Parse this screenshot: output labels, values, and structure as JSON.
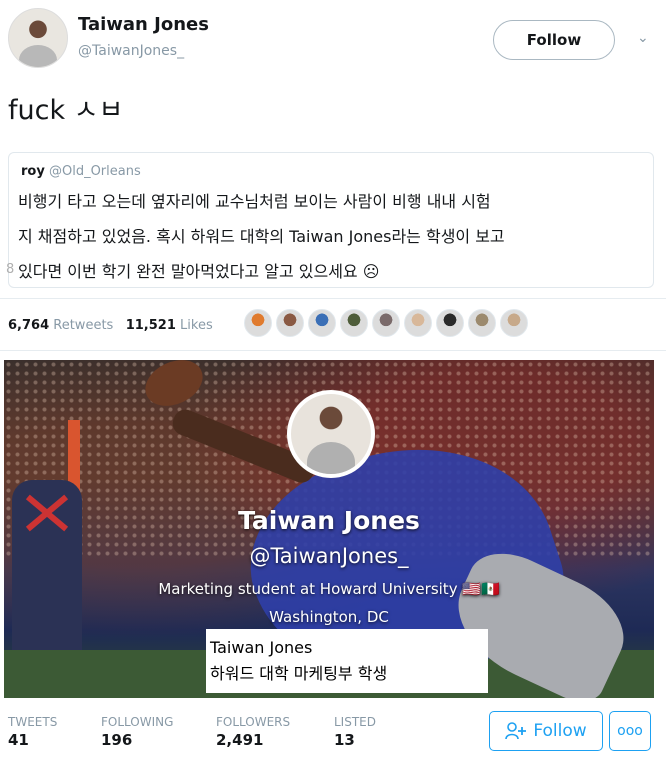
{
  "header": {
    "display_name": "Taiwan Jones",
    "handle": "@TaiwanJones_",
    "follow_label": "Follow"
  },
  "tweet": {
    "text": "fuck ㅅㅂ"
  },
  "quoted_tweet": {
    "author_name": "roy",
    "author_handle": "@Old_Orleans",
    "lines": [
      "비행기 타고 오는데 옆자리에 교수님처럼 보이는 사람이 비행 내내 시험",
      "지 채점하고 있었음. 혹시 하워드 대학의 Taiwan Jones라는 학생이 보고",
      "있다면 이번 학기 완전 말아먹었다고 알고 있으세요 ☹"
    ],
    "cut_char": "8"
  },
  "engagement": {
    "retweets_count": "6,764",
    "retweets_label": "Retweets",
    "likes_count": "11,521",
    "likes_label": "Likes",
    "liker_avatar_colors": [
      "#e07b2e",
      "#8a5a44",
      "#3b6fb6",
      "#4f5d3a",
      "#7a6a6a",
      "#d8b89a",
      "#2a2a2a",
      "#9c8a6e",
      "#c7a98a"
    ]
  },
  "profile_card": {
    "name": "Taiwan Jones",
    "handle": "@TaiwanJones_",
    "bio": "Marketing student at Howard University 🇺🇸🇲🇽",
    "location": "Washington, DC"
  },
  "caption": {
    "line1": "Taiwan Jones",
    "line2": "하워드 대학 마케팅부 학생"
  },
  "profile_stats": {
    "tweets_label": "TWEETS",
    "tweets_value": "41",
    "following_label": "FOLLOWING",
    "following_value": "196",
    "followers_label": "FOLLOWERS",
    "followers_value": "2,491",
    "listed_label": "LISTED",
    "listed_value": "13",
    "follow_label": "Follow",
    "more_label": "ooo"
  },
  "colors": {
    "accent": "#1da1f2",
    "muted": "#8899a6"
  }
}
